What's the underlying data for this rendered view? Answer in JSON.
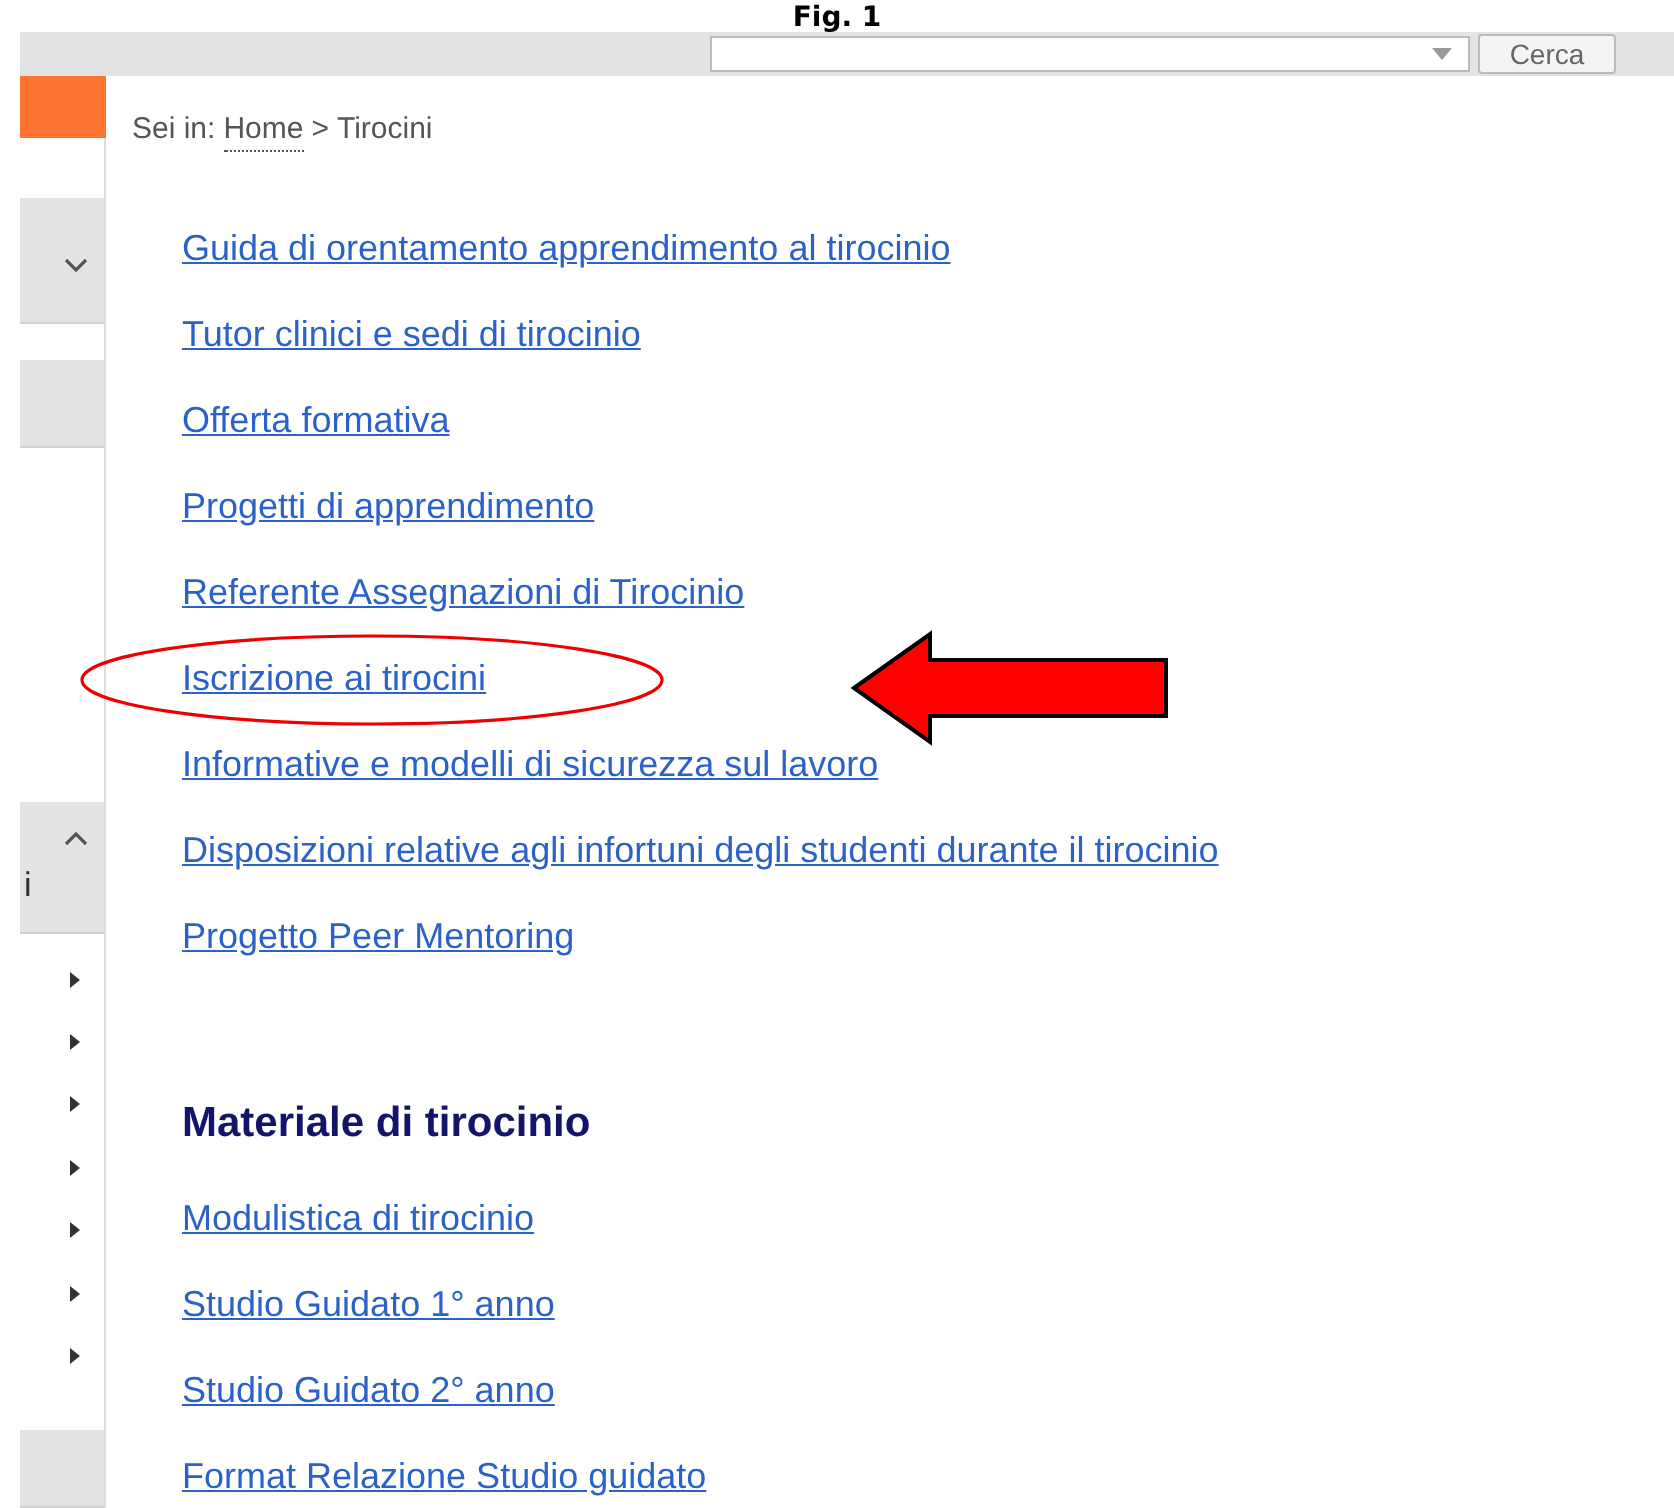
{
  "caption": "Fig. 1",
  "search": {
    "button": "Cerca"
  },
  "sidebar": [
    {
      "kind": "accent"
    },
    {
      "kind": "panel",
      "expanded": false
    },
    {
      "kind": "panel"
    },
    {
      "kind": "panel",
      "expanded": true,
      "label": "i"
    },
    {
      "kind": "item"
    },
    {
      "kind": "item"
    },
    {
      "kind": "item"
    },
    {
      "kind": "item"
    },
    {
      "kind": "item"
    },
    {
      "kind": "item"
    },
    {
      "kind": "item"
    },
    {
      "kind": "panel"
    }
  ],
  "breadcrumb": {
    "prefix": "Sei in:",
    "home": "Home",
    "separator": ">",
    "current": "Tirocini"
  },
  "links": [
    "Guida di orentamento apprendimento al tirocinio",
    "Tutor clinici e sedi di tirocinio",
    "Offerta formativa",
    "Progetti di apprendimento",
    "Referente Assegnazioni di Tirocinio",
    "Iscrizione ai tirocini",
    "Informative e modelli di sicurezza sul lavoro",
    "Disposizioni relative agli infortuni degli studenti durante il tirocinio",
    "Progetto Peer Mentoring"
  ],
  "section": {
    "title": "Materiale di tirocinio",
    "links": [
      "Modulistica di tirocinio",
      "Studio Guidato 1° anno",
      "Studio Guidato 2° anno",
      "Format Relazione Studio guidato"
    ]
  }
}
